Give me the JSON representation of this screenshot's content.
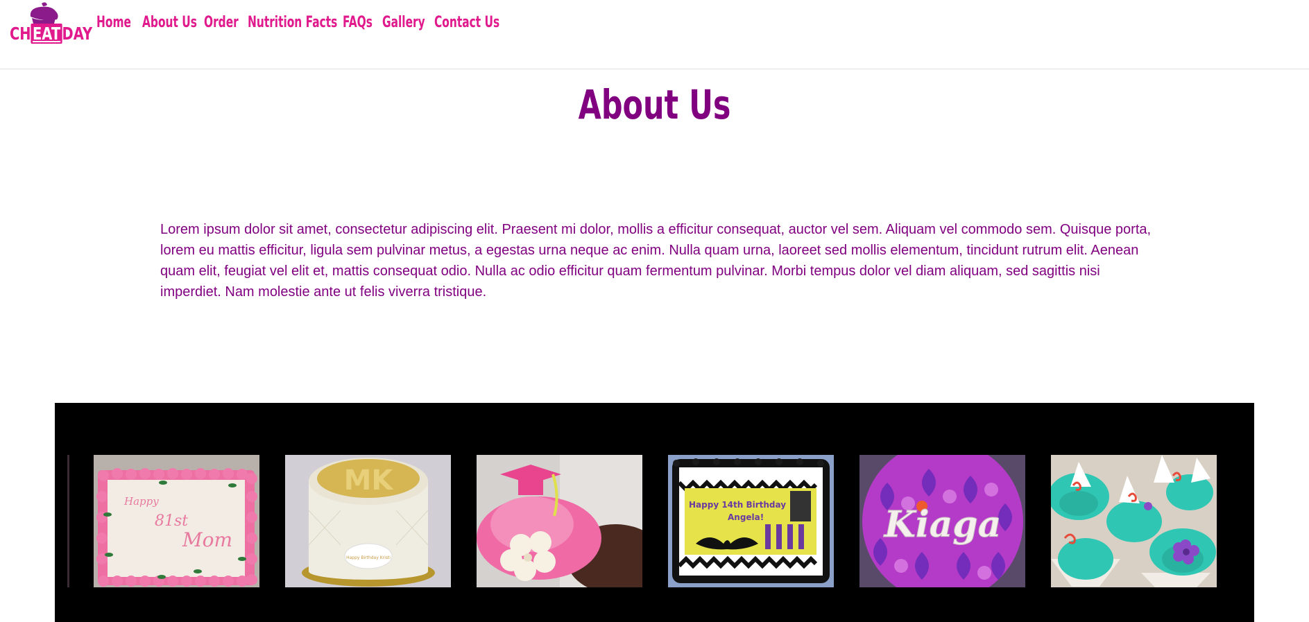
{
  "logo": {
    "prefix": "CH",
    "middle": "EAT",
    "suffix": "DAY",
    "color": "#e0198c",
    "cupcake_color": "#8b1a8b"
  },
  "nav": {
    "items": [
      "Home",
      "About Us",
      "Order",
      "Nutrition Facts",
      "FAQs",
      "Gallery",
      "Contact Us"
    ],
    "color": "#e0198c"
  },
  "page": {
    "title": "About Us",
    "title_color": "#800080",
    "paragraph": "Lorem ipsum dolor sit amet, consectetur adipiscing elit. Praesent mi dolor, mollis a efficitur consequat, auctor vel sem. Aliquam vel commodo sem. Quisque porta, lorem eu mattis efficitur, ligula sem pulvinar metus, a egestas urna neque ac enim. Nulla quam urna, laoreet sed mollis elementum, tincidunt rutrum elit. Aenean quam elit, feugiat vel elit et, mattis consequat odio. Nulla ac odio efficitur quam fermentum pulvinar. Morbi tempus dolor vel diam aliquam, sed sagittis nisi imperdiet. Nam molestie ante ut felis viverra tristique."
  },
  "gallery": {
    "background": "#000000",
    "images": [
      {
        "name": "rose-sheet-cake-image",
        "cake_text_1": "Happy",
        "cake_text_2": "81st",
        "cake_text_3": "Mom"
      },
      {
        "name": "mk-cake-image",
        "cake_text_1": "MK",
        "cake_text_2": "Happy Birthday Kristi"
      },
      {
        "name": "graduation-cupcake-image"
      },
      {
        "name": "batman-cake-image",
        "cake_text_1": "Happy 14th Birthday",
        "cake_text_2": "Angela!"
      },
      {
        "name": "kiaga-cake-image",
        "cake_text_1": "Kiaga"
      },
      {
        "name": "teal-cupcakes-image"
      }
    ]
  }
}
